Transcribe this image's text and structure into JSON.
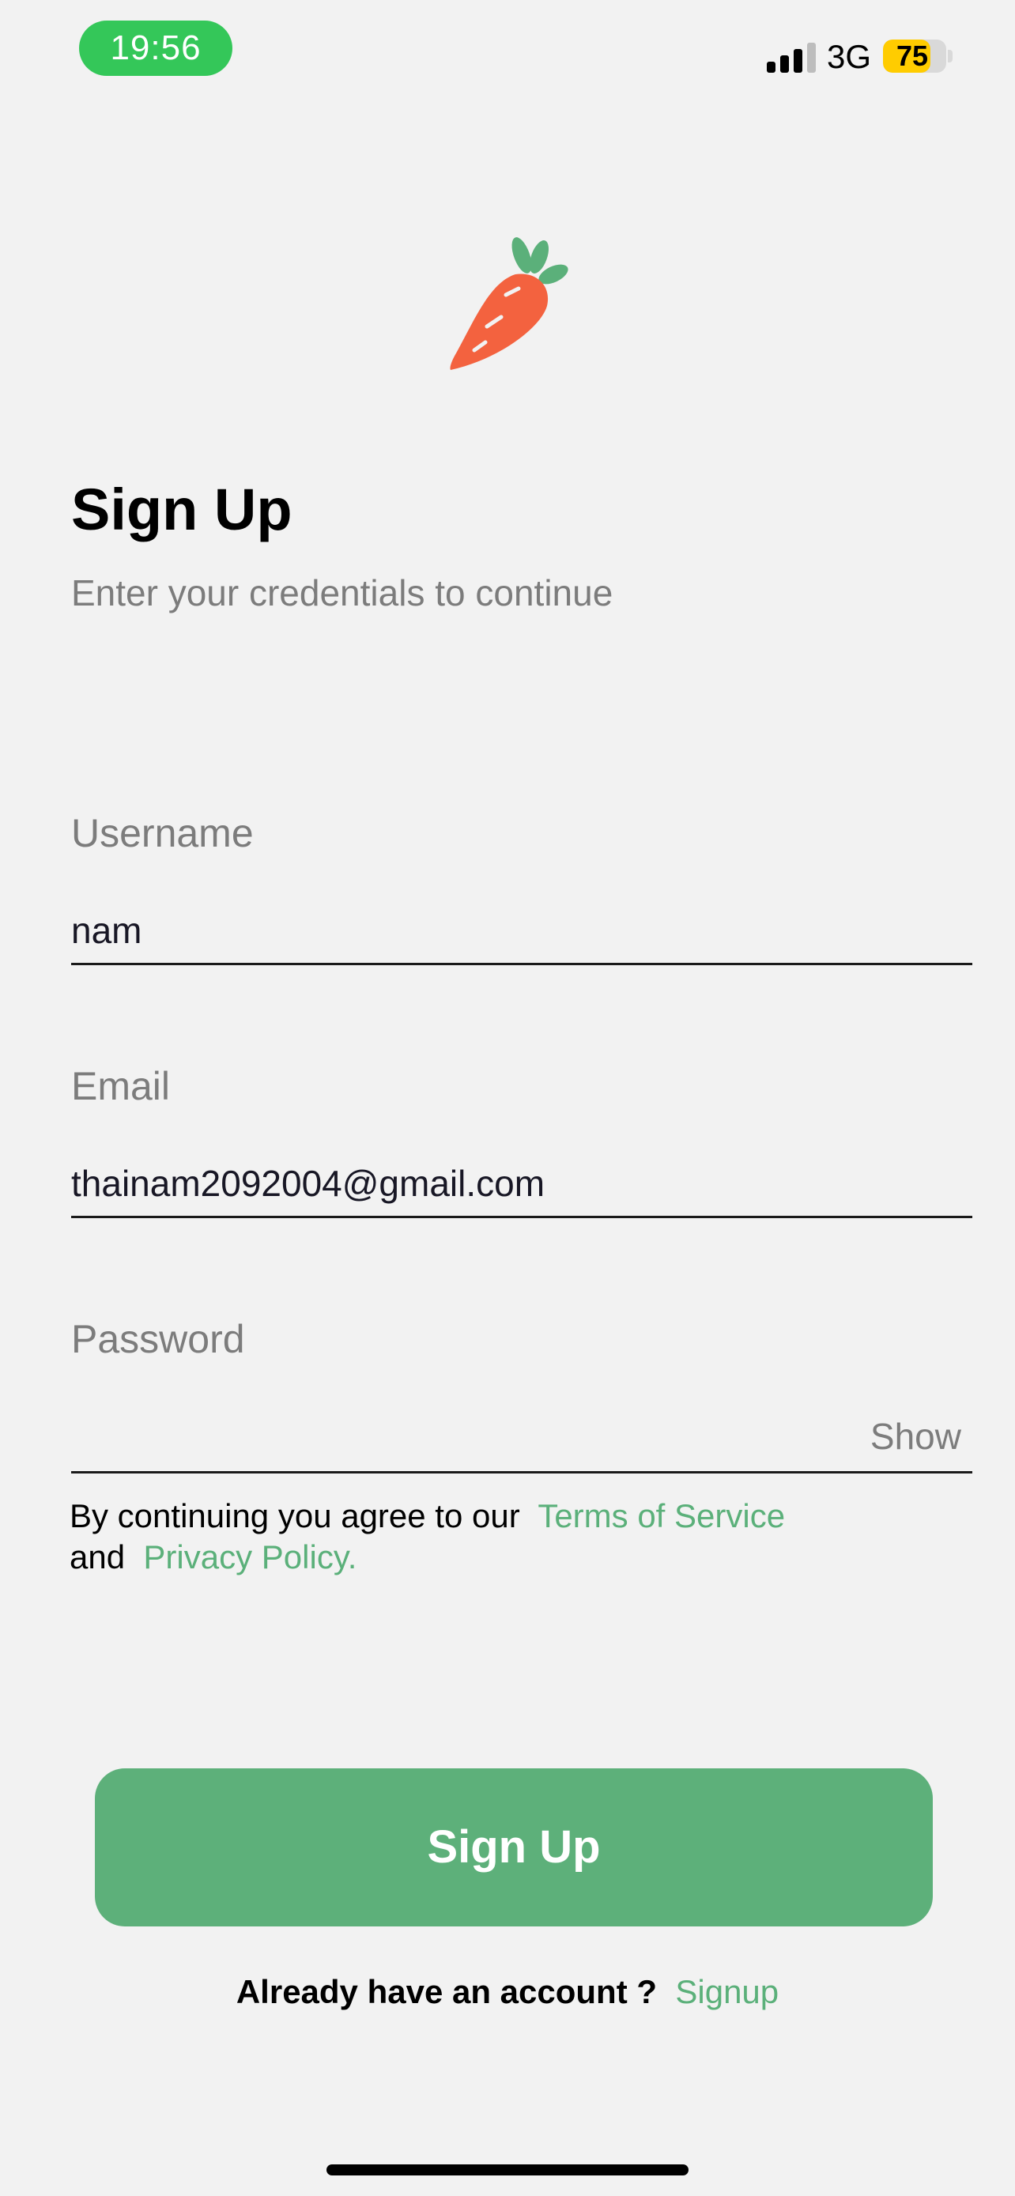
{
  "status_bar": {
    "time": "19:56",
    "network": "3G",
    "battery": "75",
    "battery_level": 0.75,
    "time_pill_color": "#34c759",
    "battery_color": "#ffcc00"
  },
  "logo": {
    "icon": "carrot-icon",
    "color": "#f3623f",
    "leaf_color": "#5bb07a"
  },
  "header": {
    "title": "Sign Up",
    "subtitle": "Enter your credentials to continue"
  },
  "form": {
    "username": {
      "label": "Username",
      "value": "nam"
    },
    "email": {
      "label": "Email",
      "value": "thainam2092004@gmail.com"
    },
    "password": {
      "label": "Password",
      "value": "",
      "toggle_label": "Show"
    }
  },
  "terms": {
    "prefix": "By continuing you agree to our",
    "terms_link": "Terms of Service",
    "and": "and",
    "privacy_link": "Privacy Policy."
  },
  "submit": {
    "label": "Sign Up",
    "color": "#5db07a"
  },
  "footer": {
    "prompt": "Already have an account ?",
    "link": "Signup",
    "link_color": "#5bb07a"
  }
}
